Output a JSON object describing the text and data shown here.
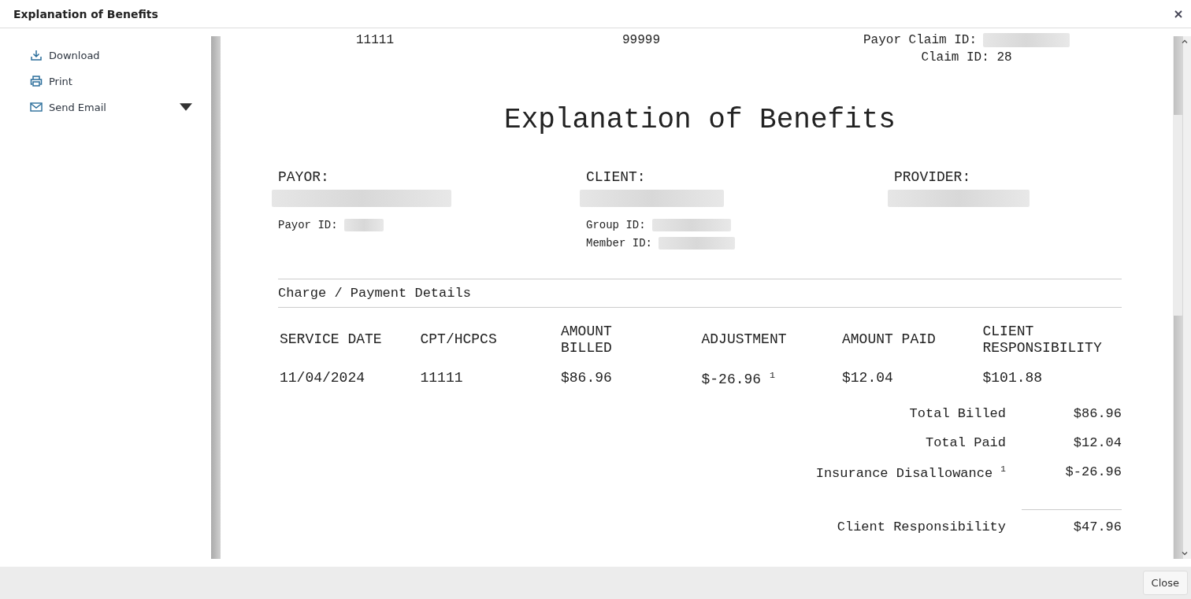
{
  "dialog": {
    "title": "Explanation of Benefits"
  },
  "sidebar": {
    "actions": [
      {
        "kind": "download",
        "label": "Download",
        "dropdown": false
      },
      {
        "kind": "print",
        "label": "Print",
        "dropdown": false
      },
      {
        "kind": "email",
        "label": "Send Email",
        "dropdown": true
      }
    ]
  },
  "document": {
    "header_values": [
      "11111",
      "99999"
    ],
    "payor_claim_id": {
      "label": "Payor Claim ID:",
      "redacted": true
    },
    "claim_id": "Claim ID: 28",
    "title": "Explanation of Benefits",
    "parties": [
      {
        "heading": "PAYOR:",
        "name_redacted": true,
        "fields": [
          {
            "label": "Payor ID:",
            "redacted": true
          }
        ]
      },
      {
        "heading": "CLIENT:",
        "name_redacted": true,
        "fields": [
          {
            "label": "Group ID:",
            "redacted": true
          },
          {
            "label": "Member ID:",
            "redacted": true
          }
        ]
      },
      {
        "heading": "PROVIDER:",
        "name_redacted": true
      }
    ],
    "section_title": "Charge / Payment Details",
    "table": {
      "columns": [
        "SERVICE DATE",
        "CPT/HCPCS",
        "AMOUNT BILLED",
        "ADJUSTMENT",
        "AMOUNT PAID",
        "CLIENT RESPONSIBILITY"
      ],
      "rows": [
        [
          "11/04/2024",
          "11111",
          "$86.96",
          "$-26.96 $^{1}$",
          "$12.04",
          "$101.88"
        ]
      ]
    },
    "totals": [
      {
        "label": "Total Billed",
        "value": "$86.96",
        "rule_above": false
      },
      {
        "label": "Total Paid",
        "value": "$12.04",
        "rule_above": false
      },
      {
        "label": "Insurance Disallowance $^{1}$",
        "value": "$-26.96",
        "rule_above": false
      },
      {
        "label": "Client Responsibility",
        "value": "$47.96",
        "rule_above": true
      }
    ]
  },
  "footer": {
    "buttons": [
      "Close"
    ]
  }
}
